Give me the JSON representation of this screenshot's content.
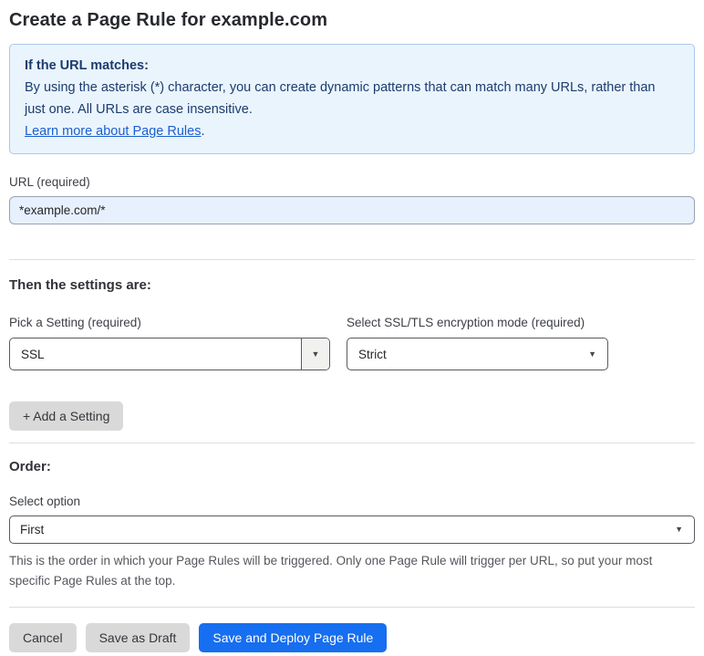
{
  "page": {
    "title": "Create a Page Rule for example.com"
  },
  "info_box": {
    "heading": "If the URL matches:",
    "body": "By using the asterisk (*) character, you can create dynamic patterns that can match many URLs, rather than just one. All URLs are case insensitive.",
    "link_label": "Learn more about Page Rules",
    "link_suffix": "."
  },
  "url_field": {
    "label": "URL (required)",
    "value": "*example.com/*"
  },
  "settings_section": {
    "heading": "Then the settings are:",
    "setting_select": {
      "label": "Pick a Setting (required)",
      "value": "SSL"
    },
    "mode_select": {
      "label": "Select SSL/TLS encryption mode (required)",
      "value": "Strict"
    },
    "add_setting_label": "+ Add a Setting"
  },
  "order_section": {
    "heading": "Order:",
    "select_label": "Select option",
    "value": "First",
    "help_text": "This is the order in which your Page Rules will be triggered. Only one Page Rule will trigger per URL, so put your most specific Page Rules at the top."
  },
  "footer": {
    "cancel_label": "Cancel",
    "save_draft_label": "Save as Draft",
    "save_deploy_label": "Save and Deploy Page Rule"
  },
  "icons": {
    "dropdown_arrow": "▼"
  },
  "colors": {
    "accent_blue": "#166ef0",
    "info_background": "#eaf4fd",
    "info_border": "#a9c8e8",
    "info_text": "#1b3c6e",
    "link_blue": "#1a5fce",
    "input_filled_background": "#e7f0fd",
    "button_gray": "#d9d9d9"
  }
}
